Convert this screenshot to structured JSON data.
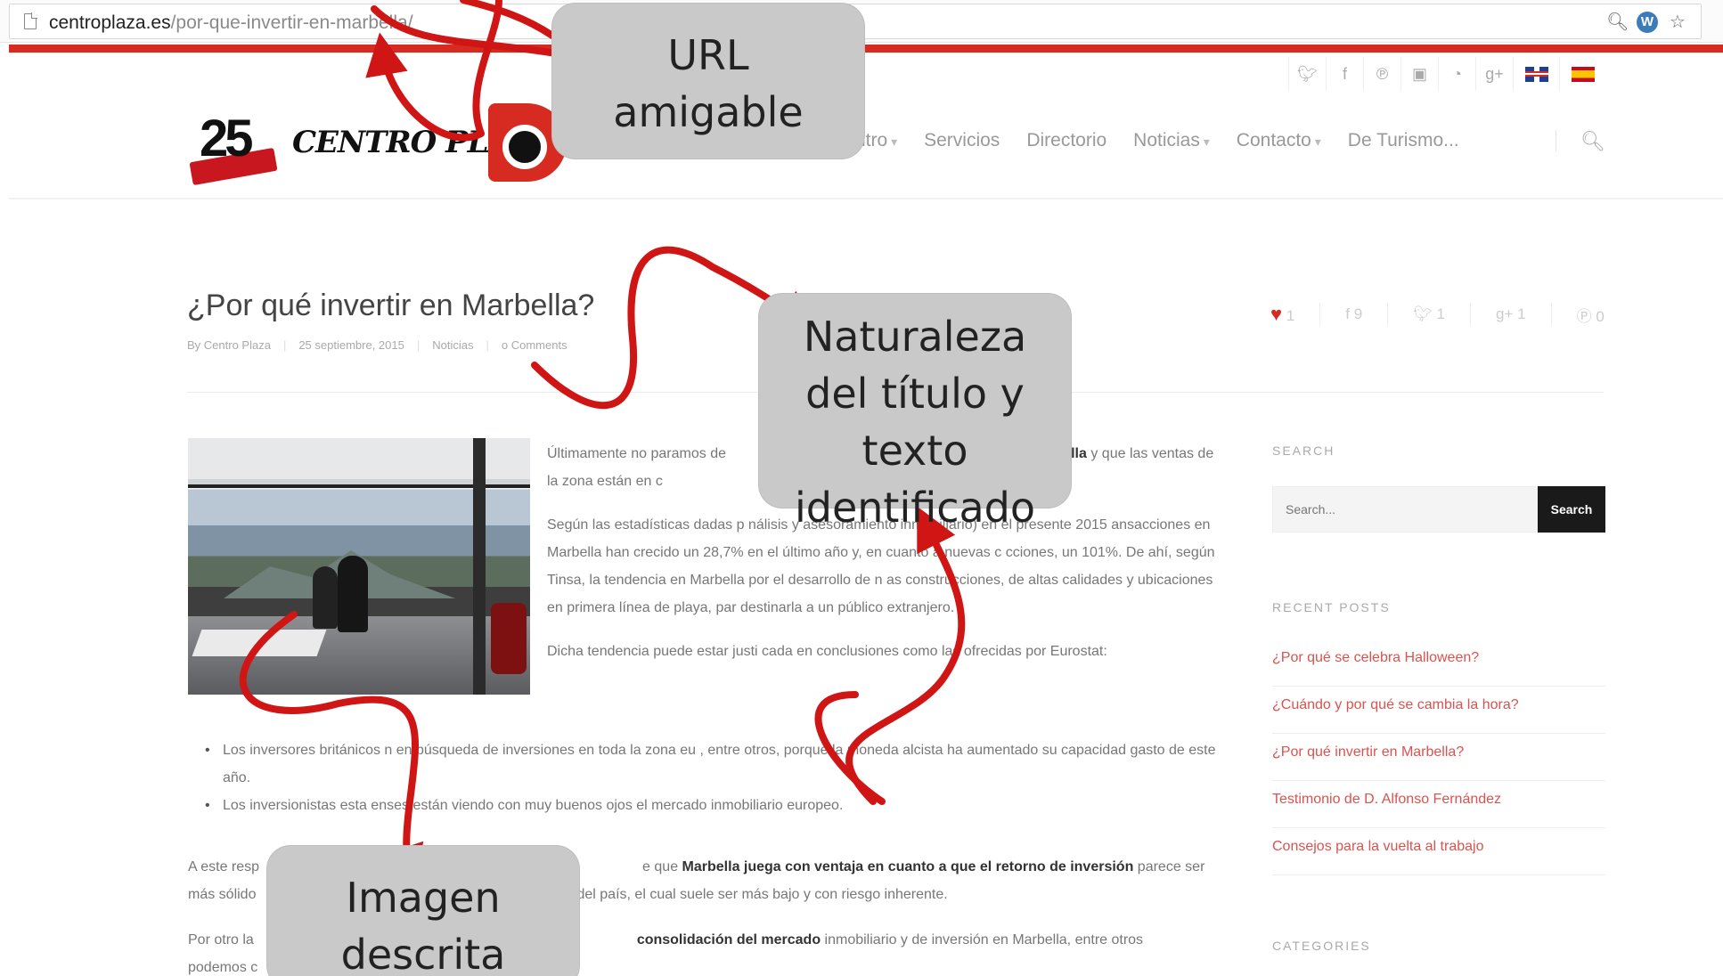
{
  "browser": {
    "url_domain": "centroplaza.es",
    "url_path": "/por-que-invertir-en-marbella/"
  },
  "site": {
    "logo_number": "25",
    "logo_text": "CENTRO PLAZA",
    "nav": [
      "ntro",
      "Servicios",
      "Directorio",
      "Noticias",
      "Contacto",
      "De Turismo..."
    ],
    "social_icons": [
      "twitter-icon",
      "facebook-icon",
      "pinterest-icon",
      "youtube-icon",
      "rss-icon",
      "google-plus-icon"
    ],
    "flags": [
      "uk-flag-icon",
      "spain-flag-icon"
    ]
  },
  "post": {
    "title": "¿Por qué invertir en Marbella?",
    "meta": {
      "author": "By Centro Plaza",
      "date": "25 septiembre, 2015",
      "category": "Noticias",
      "comments": "o Comments"
    },
    "share_counts": [
      "1",
      "9",
      "1",
      "1",
      "0"
    ],
    "paragraphs": [
      {
        "before": "Últimamente no paramos de",
        "bold": "Marbella",
        "after": "y que las ventas de la zona están en c"
      },
      {
        "text": "Según las estadísticas dadas p nálisis y asesoramiento inmobiliario) en el presente 2015 ansacciones en Marbella han crecido un 28,7% en el último año y, en cuanto a nuevas c cciones, un 101%. De ahí, según Tinsa, la tendencia en Marbella por el desarrollo de n as construcciones, de altas calidades y ubicaciones en primera línea de playa, par destinarla a un público extranjero."
      },
      {
        "text": "Dicha tendencia puede estar justi cada en conclusiones como las ofrecidas por Eurostat:"
      }
    ],
    "bullets": [
      "Los inversores británicos n en búsqueda de inversiones en toda la zona eu , entre otros, porque la moneda alcista ha aumentado su capacidad gasto de este año.",
      "Los inversionistas esta enses están viendo con muy buenos ojos el mercado inmobiliario europeo."
    ],
    "para2": {
      "before": "A este resp",
      "mid": "e que",
      "bold": "Marbella juega con ventaja en cuanto a que el retorno de inversión",
      "after": "parece ser más sólido",
      "line2": "del país, el cual suele ser más bajo y con riesgo inherente."
    },
    "para3": {
      "before": "Por otro la",
      "bold": "consolidación del mercado",
      "after": "inmobiliario y de inversión en Marbella, entre otros",
      "line2": "podemos c"
    }
  },
  "sidebar": {
    "search_title": "SEARCH",
    "search_placeholder": "Search...",
    "search_button": "Search",
    "recent_title": "RECENT POSTS",
    "recent_posts": [
      "¿Por qué se celebra Halloween?",
      "¿Cuándo y por qué se cambia la hora?",
      "¿Por qué invertir en Marbella?",
      "Testimonio de D. Alfonso Fernández",
      "Consejos para la vuelta al trabajo"
    ],
    "categories_title": "CATEGORIES"
  },
  "annotations": {
    "url": [
      "URL",
      "amigable"
    ],
    "title": [
      "Naturaleza",
      "del título y",
      "texto",
      "identificado"
    ],
    "image": [
      "Imagen",
      "descrita"
    ]
  },
  "colors": {
    "accent_red": "#d72a20",
    "callout_gray": "#c9c9c9",
    "link_red": "#d9534f"
  }
}
